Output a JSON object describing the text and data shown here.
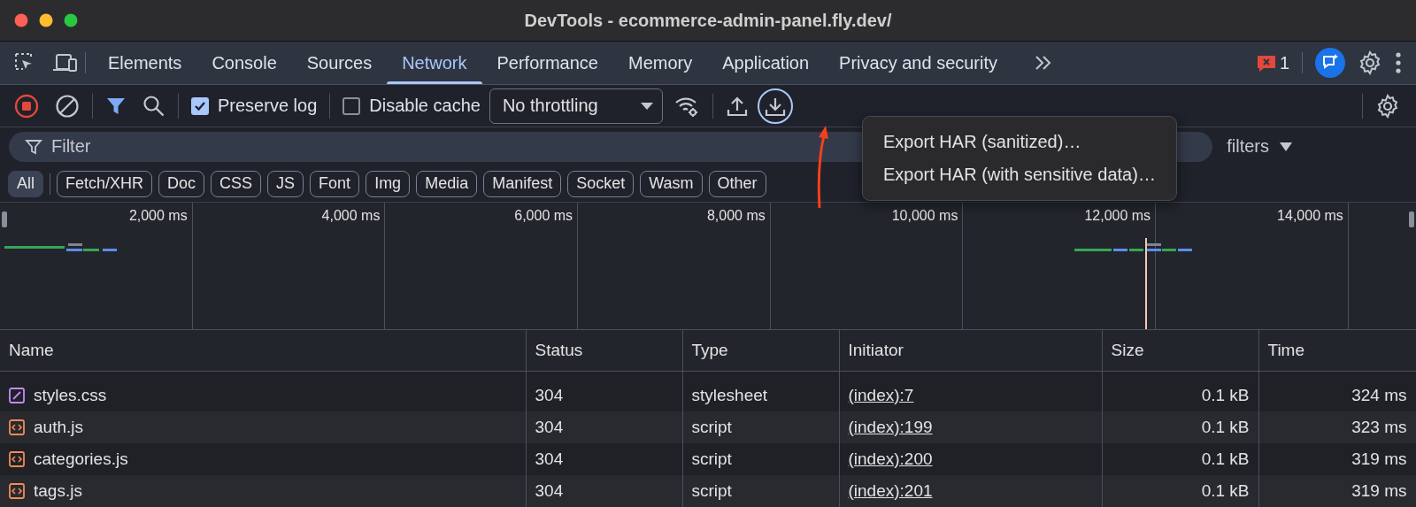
{
  "window": {
    "title": "DevTools - ecommerce-admin-panel.fly.dev/"
  },
  "panel_tabs": [
    {
      "label": "Elements",
      "selected": false
    },
    {
      "label": "Console",
      "selected": false
    },
    {
      "label": "Sources",
      "selected": false
    },
    {
      "label": "Network",
      "selected": true
    },
    {
      "label": "Performance",
      "selected": false
    },
    {
      "label": "Memory",
      "selected": false
    },
    {
      "label": "Application",
      "selected": false
    },
    {
      "label": "Privacy and security",
      "selected": false
    }
  ],
  "issues": {
    "count": "1"
  },
  "toolbar": {
    "preserve_log": {
      "label": "Preserve log",
      "checked": true
    },
    "disable_cache": {
      "label": "Disable cache",
      "checked": false
    },
    "throttling": {
      "value": "No throttling"
    }
  },
  "export_menu": {
    "items": [
      "Export HAR (sanitized)…",
      "Export HAR (with sensitive data)…"
    ]
  },
  "filter": {
    "placeholder": "Filter",
    "more_filters": "filters"
  },
  "type_filters": [
    {
      "label": "All",
      "selected": true
    },
    {
      "label": "Fetch/XHR",
      "selected": false
    },
    {
      "label": "Doc",
      "selected": false
    },
    {
      "label": "CSS",
      "selected": false
    },
    {
      "label": "JS",
      "selected": false
    },
    {
      "label": "Font",
      "selected": false
    },
    {
      "label": "Img",
      "selected": false
    },
    {
      "label": "Media",
      "selected": false
    },
    {
      "label": "Manifest",
      "selected": false
    },
    {
      "label": "Socket",
      "selected": false
    },
    {
      "label": "Wasm",
      "selected": false
    },
    {
      "label": "Other",
      "selected": false
    }
  ],
  "overview": {
    "ticks": [
      "2,000 ms",
      "4,000 ms",
      "6,000 ms",
      "8,000 ms",
      "10,000 ms",
      "12,000 ms",
      "14,000 ms"
    ]
  },
  "table": {
    "columns": [
      "Name",
      "Status",
      "Type",
      "Initiator",
      "Size",
      "Time"
    ],
    "rows": [
      {
        "kind": "stylesheet",
        "name": "styles.css",
        "status": "304",
        "type": "stylesheet",
        "initiator": "(index):7",
        "size": "0.1 kB",
        "time": "324 ms"
      },
      {
        "kind": "script",
        "name": "auth.js",
        "status": "304",
        "type": "script",
        "initiator": "(index):199",
        "size": "0.1 kB",
        "time": "323 ms"
      },
      {
        "kind": "script",
        "name": "categories.js",
        "status": "304",
        "type": "script",
        "initiator": "(index):200",
        "size": "0.1 kB",
        "time": "319 ms"
      },
      {
        "kind": "script",
        "name": "tags.js",
        "status": "304",
        "type": "script",
        "initiator": "(index):201",
        "size": "0.1 kB",
        "time": "319 ms"
      }
    ]
  }
}
